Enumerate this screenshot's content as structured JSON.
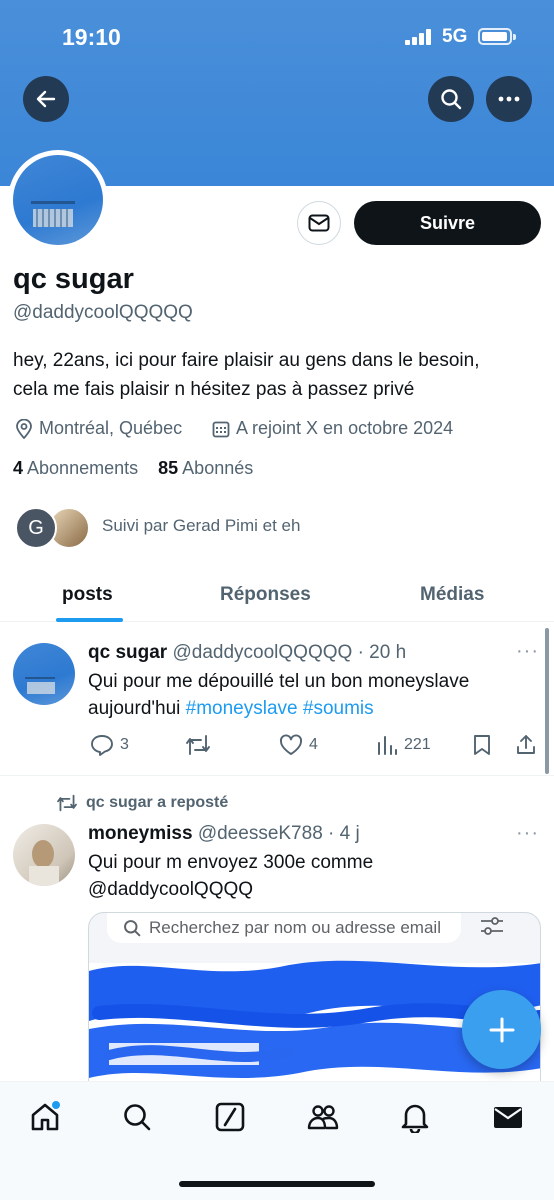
{
  "status_bar": {
    "time": "19:10",
    "network": "5G"
  },
  "profile": {
    "display_name": "qc sugar",
    "handle": "@daddycoolQQQQQ",
    "bio_line1": "hey, 22ans, ici pour faire plaisir au gens dans le besoin,",
    "bio_line2": "cela me fais plaisir n hésitez pas à passez privé",
    "location": "Montréal, Québec",
    "joined": "A rejoint X en octobre 2024",
    "following_count": "4",
    "following_label": "Abonnements",
    "followers_count": "85",
    "followers_label": "Abonnés",
    "followed_by": "Suivi par Gerad Pimi et eh",
    "follower_avatar_letter": "G"
  },
  "actions": {
    "follow_label": "Suivre"
  },
  "tabs": [
    {
      "label": "posts",
      "active": true
    },
    {
      "label": "Réponses",
      "active": false
    },
    {
      "label": "Médias",
      "active": false
    }
  ],
  "posts": [
    {
      "author": "qc sugar",
      "handle": "@daddycoolQQQQQ",
      "time": "· 20 h",
      "text_line1": "Qui pour me dépouillé tel un bon moneyslave",
      "text_line2_prefix": "aujourd'hui ",
      "hashtag1": "#moneyslave",
      "hashtag2": "#soumis",
      "replies": "3",
      "retweets": "",
      "likes": "4",
      "views": "221"
    },
    {
      "repost_label": "qc sugar a reposté",
      "author": "moneymiss",
      "handle": "@deesseK788",
      "time": "· 4 j",
      "text_line1": "Qui pour m envoyez 300e comme",
      "text_line2": "@daddycoolQQQQ",
      "media_search_placeholder": "Recherchez par nom ou adresse email"
    }
  ],
  "colors": {
    "accent": "#1d9bf0",
    "banner": "#3b86d8",
    "fab": "#3b9ff0",
    "dark": "#0f1419"
  },
  "icons": [
    "back-arrow-icon",
    "search-icon",
    "more-icon",
    "mail-icon",
    "location-icon",
    "calendar-icon",
    "reply-icon",
    "retweet-icon",
    "like-icon",
    "views-icon",
    "bookmark-icon",
    "share-icon",
    "plus-icon",
    "home-icon",
    "explore-icon",
    "grok-icon",
    "communities-icon",
    "notifications-icon",
    "messages-icon"
  ]
}
